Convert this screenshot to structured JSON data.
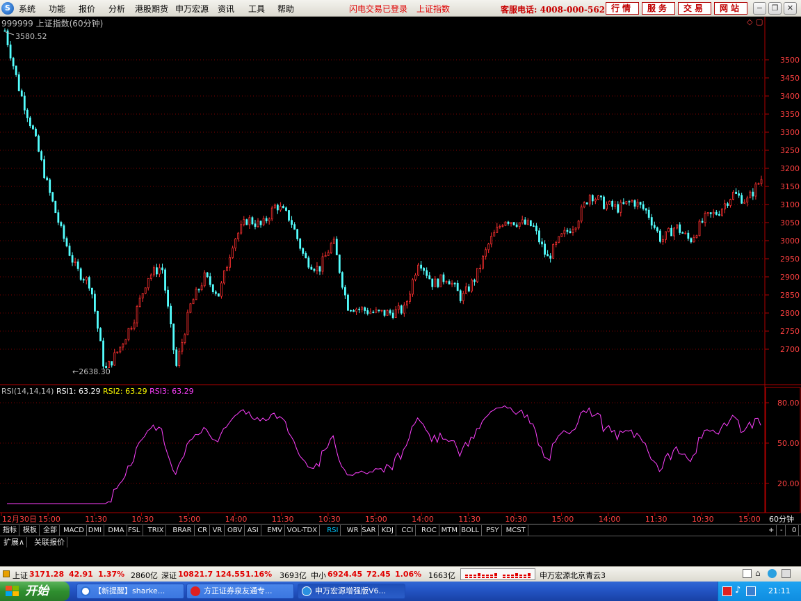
{
  "menu": {
    "items": [
      "系统",
      "功能",
      "报价",
      "分析",
      "港股期货",
      "申万宏源",
      "资讯",
      "工具",
      "帮助"
    ],
    "status1": "闪电交易已登录",
    "status2": "上证指数",
    "hotline": "客服电话: 4008-000-562",
    "buttons": [
      "行情",
      "服务",
      "交易",
      "网站"
    ]
  },
  "chart": {
    "title": "999999 上证指数(60分钟)",
    "high_label": "3580.52",
    "low_label": "2638.30",
    "price_ticks": [
      "3500",
      "3450",
      "3400",
      "3350",
      "3300",
      "3250",
      "3200",
      "3150",
      "3100",
      "3050",
      "3000",
      "2950",
      "2900",
      "2850",
      "2800",
      "2750",
      "2700"
    ],
    "time_ticks": [
      "12月30日",
      "15:00",
      "11:30",
      "10:30",
      "15:00",
      "14:00",
      "11:30",
      "10:30",
      "15:00",
      "14:00",
      "11:30",
      "10:30",
      "15:00",
      "14:00",
      "11:30",
      "10:30",
      "15:00"
    ],
    "period": "60分钟"
  },
  "rsi": {
    "name": "RSI(14,14,14)",
    "rsi1_label": "RSI1: 63.29",
    "rsi2_label": "RSI2: 63.29",
    "rsi3_label": "RSI3: 63.29",
    "ticks": [
      "80.00",
      "50.00",
      "20.00"
    ],
    "colors": {
      "rsi1": "#ffffff",
      "rsi2": "#ffff00",
      "rsi3": "#ff40ff"
    }
  },
  "chart_data": {
    "type": "candlestick",
    "title": "999999 上证指数(60分钟)",
    "ylim": [
      2600,
      3600
    ],
    "price_series_keypoints": [
      3580.52,
      3420,
      3300,
      3150,
      3020,
      2920,
      2880,
      2638.3,
      2700,
      2780,
      2900,
      2930,
      2650,
      2820,
      2900,
      2850,
      3000,
      3060,
      3040,
      3100,
      3060,
      2950,
      2920,
      3000,
      2820,
      2810,
      2800,
      2800,
      2810,
      2950,
      2880,
      2900,
      2840,
      2900,
      3000,
      3060,
      3050,
      3040,
      2950,
      3010,
      3050,
      3130,
      3100,
      3090,
      3110,
      3080,
      3000,
      3040,
      3000,
      3060,
      3080,
      3130,
      3110,
      3171.28
    ],
    "rsi": {
      "ylim": [
        0,
        100
      ],
      "last": 63.29,
      "ticks": [
        80,
        50,
        20
      ]
    }
  },
  "indicators": {
    "tabs": [
      "指标",
      "模板",
      "全部",
      "MACD",
      "DMI",
      "DMA",
      "FSL",
      "TRIX",
      "BRAR",
      "CR",
      "VR",
      "OBV",
      "ASI",
      "EMV",
      "VOL-TDX",
      "RSI",
      "WR",
      "SAR",
      "KDJ",
      "CCI",
      "ROC",
      "MTM",
      "BOLL",
      "PSY",
      "MCST"
    ],
    "selected": "RSI",
    "ctrl": [
      "+",
      "-",
      "0"
    ]
  },
  "expand": {
    "tabs": [
      "扩展∧",
      "关联报价"
    ]
  },
  "statusbar": {
    "sh_name": "上证",
    "sh_price": "3171.28",
    "sh_chg": "42.91",
    "sh_pct": "1.37%",
    "sh_amt": "2860亿",
    "sz_name": "深证",
    "sz_price": "10821.7",
    "sz_chg": "124.55",
    "sz_pct": "1.16%",
    "sz_amt": "3693亿",
    "zx_name": "中小",
    "zx_price": "6924.45",
    "zx_chg": "72.45",
    "zx_pct": "1.06%",
    "zx_amt": "1663亿",
    "broker": "申万宏源北京青云3"
  },
  "taskbar": {
    "start": "开始",
    "tasks": [
      "【新提醒】sharke...",
      "方正证券泉友通专...",
      "申万宏源增强版V6..."
    ],
    "clock": "21:11"
  }
}
